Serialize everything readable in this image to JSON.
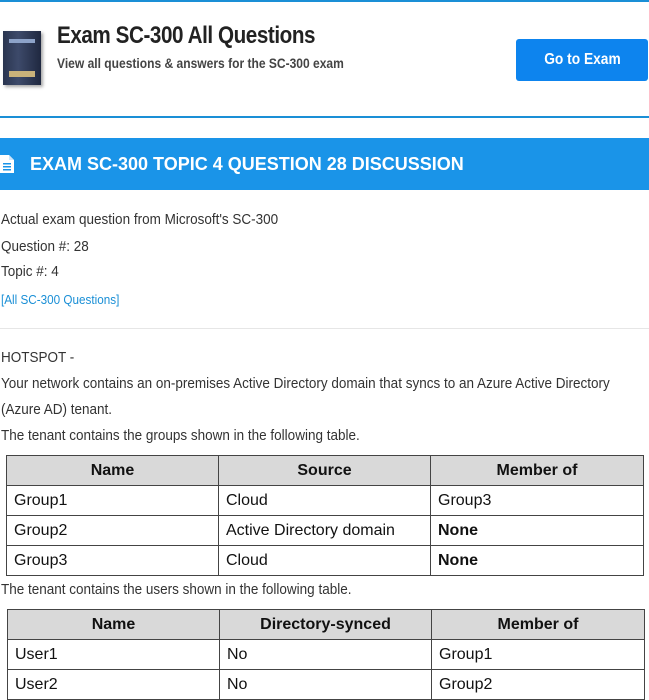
{
  "header": {
    "title": "Exam SC-300 All Questions",
    "subtitle": "View all questions & answers for the SC-300 exam",
    "go_button": "Go to Exam"
  },
  "banner": {
    "title": "EXAM SC-300 TOPIC 4 QUESTION 28 DISCUSSION"
  },
  "meta": {
    "source": "Actual exam question from Microsoft's SC-300",
    "question": "Question #: 28",
    "topic": "Topic #: 4",
    "all_link": "[All SC-300 Questions]"
  },
  "question": {
    "type": "HOTSPOT -",
    "line1": "Your network contains an on-premises Active Directory domain that syncs to an Azure Active Directory",
    "line2": "(Azure AD) tenant.",
    "groups_intro": "The tenant contains the groups shown in the following table.",
    "users_intro": "The tenant contains the users shown in the following table."
  },
  "groups_table": {
    "headers": [
      "Name",
      "Source",
      "Member of"
    ],
    "rows": [
      [
        "Group1",
        "Cloud",
        "Group3"
      ],
      [
        "Group2",
        "Active Directory domain",
        "None"
      ],
      [
        "Group3",
        "Cloud",
        "None"
      ]
    ]
  },
  "users_table": {
    "headers": [
      "Name",
      "Directory-synced",
      "Member of"
    ],
    "rows": [
      [
        "User1",
        "No",
        "Group1"
      ],
      [
        "User2",
        "No",
        "Group2"
      ]
    ]
  }
}
